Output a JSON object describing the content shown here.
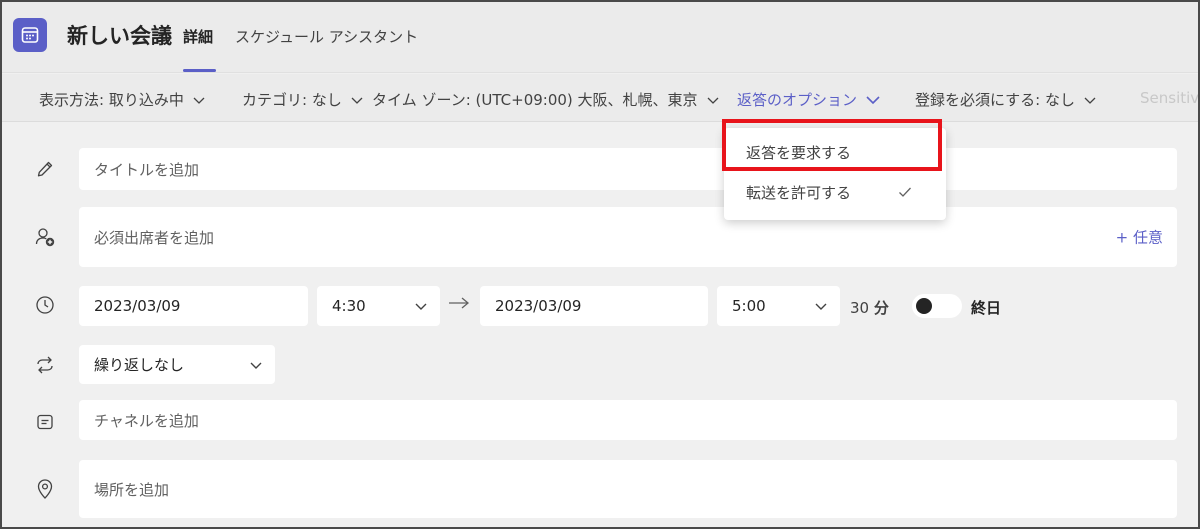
{
  "header": {
    "title": "新しい会議",
    "tabs": [
      {
        "label": "詳細",
        "active": true
      },
      {
        "label": "スケジュール アシスタント",
        "active": false
      }
    ]
  },
  "options_bar": {
    "show_as": "表示方法: 取り込み中",
    "category": "カテゴリ: なし",
    "timezone": "タイム ゾーン: (UTC+09:00) 大阪、札幌、東京",
    "response_options": "返答のオプション",
    "registration": "登録を必須にする: なし",
    "sensitivity": "Sensitiv"
  },
  "dropdown": {
    "items": [
      {
        "label": "返答を要求する",
        "checked": false,
        "highlighted": true
      },
      {
        "label": "転送を許可する",
        "checked": true,
        "highlighted": false
      }
    ]
  },
  "form": {
    "title_placeholder": "タイトルを追加",
    "attendees_placeholder": "必須出席者を追加",
    "optional_label": "+ 任意",
    "start_date": "2023/03/09",
    "start_time": "4:30",
    "end_date": "2023/03/09",
    "end_time": "5:00",
    "duration_num": "30",
    "duration_unit": "分",
    "all_day_label": "終日",
    "all_day_on": false,
    "repeat": "繰り返しなし",
    "channel_placeholder": "チャネルを追加",
    "location_placeholder": "場所を追加"
  },
  "colors": {
    "accent": "#5b5fc7",
    "highlight_box": "#e8141b",
    "field_bg": "#ffffff",
    "page_bg": "#f0f0f0"
  },
  "icons": {
    "app": "calendar-icon",
    "title_row": "pencil-icon",
    "attendees_row": "person-add-icon",
    "time_row": "clock-icon",
    "repeat_row": "repeat-icon",
    "channel_row": "channel-icon",
    "location_row": "location-pin-icon"
  }
}
